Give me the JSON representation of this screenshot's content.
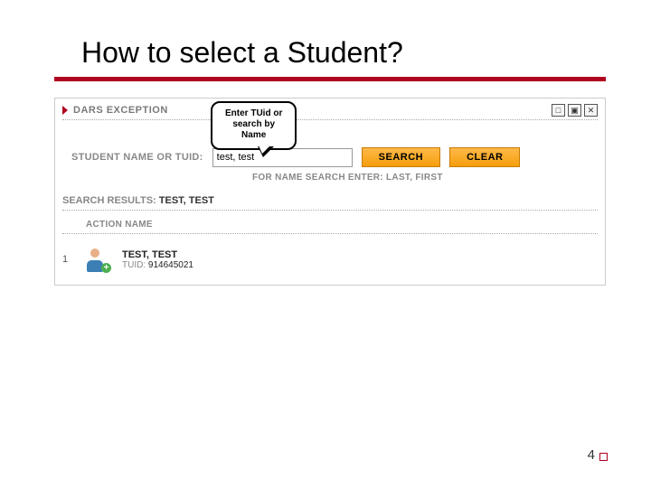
{
  "slide": {
    "title": "How to select a Student?",
    "page_number": "4"
  },
  "panel": {
    "title": "DARS EXCEPTION"
  },
  "callout": {
    "line1": "Enter TUid or",
    "line2": "search by",
    "line3": "Name"
  },
  "search": {
    "label": "STUDENT NAME OR TUID:",
    "value": "test, test",
    "search_button": "SEARCH",
    "clear_button": "CLEAR",
    "hint": "FOR NAME SEARCH ENTER: LAST, FIRST"
  },
  "results": {
    "label_prefix": "SEARCH RESULTS:",
    "label_value": "TEST, TEST",
    "column_header": "ACTION NAME",
    "rows": [
      {
        "num": "1",
        "name": "TEST, TEST",
        "tuid_label": "TUID:",
        "tuid_value": "914645021"
      }
    ]
  },
  "win_icons": {
    "min": "□",
    "max": "▣",
    "close": "✕"
  }
}
